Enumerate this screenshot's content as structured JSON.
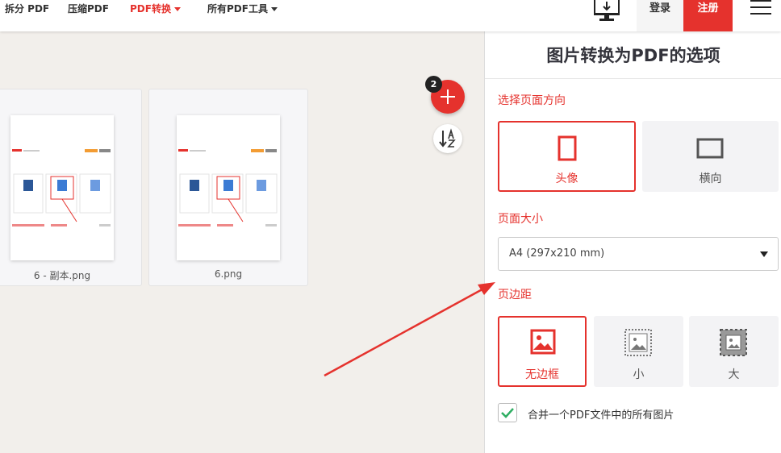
{
  "nav": {
    "items": [
      "拆分 PDF",
      "压缩PDF",
      "PDF转换",
      "所有PDF工具"
    ],
    "login": "登录",
    "signup": "注册"
  },
  "workspace": {
    "files": [
      {
        "name": "6 - 副本.png"
      },
      {
        "name": "6.png"
      }
    ],
    "file_count": "2"
  },
  "panel": {
    "title": "图片转换为PDF的选项",
    "orientation": {
      "label": "选择页面方向",
      "options": [
        "头像",
        "横向"
      ],
      "selected": "头像"
    },
    "page_size": {
      "label": "页面大小",
      "value": "A4 (297x210 mm)"
    },
    "margin": {
      "label": "页边距",
      "options": [
        "无边框",
        "小",
        "大"
      ],
      "selected": "无边框"
    },
    "merge": {
      "label": "合并一个PDF文件中的所有图片",
      "checked": true
    }
  },
  "colors": {
    "accent": "#e5322d",
    "check": "#2fae63"
  }
}
